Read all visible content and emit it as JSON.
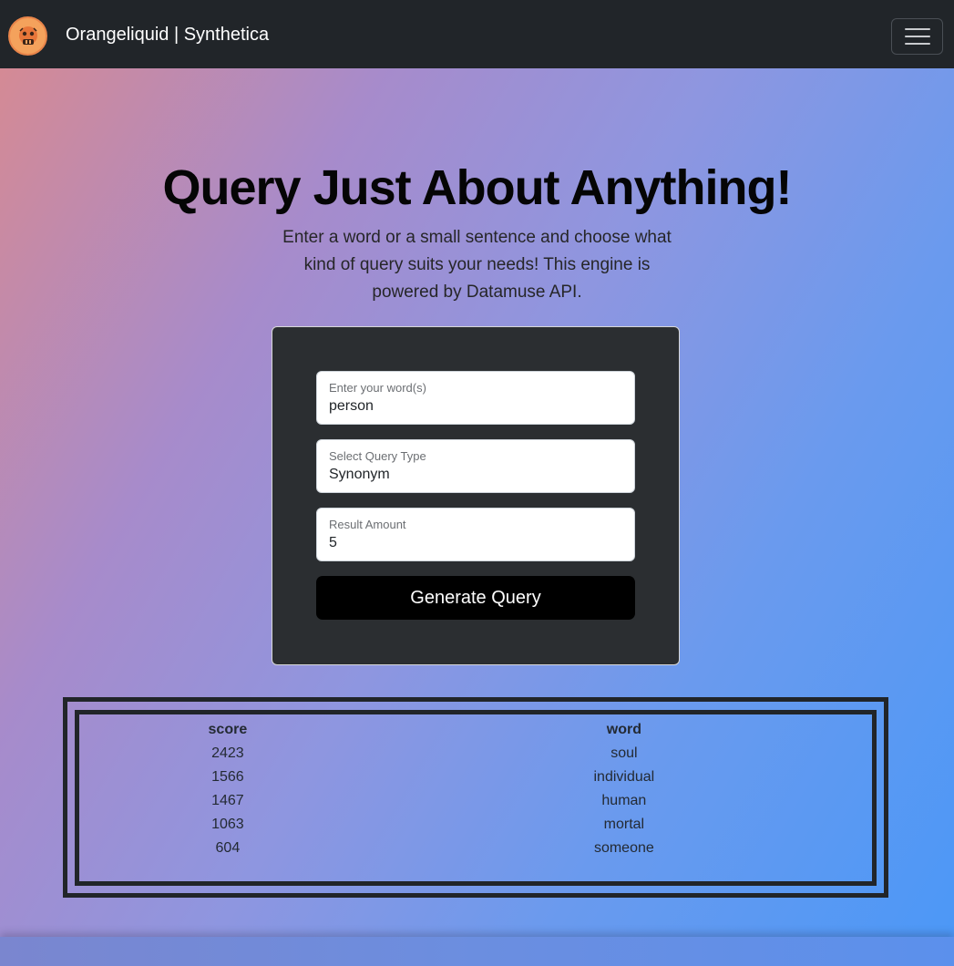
{
  "navbar": {
    "brand": "Orangeliquid | Synthetica",
    "logo_icon": "orange-mascot-icon",
    "menu_icon": "hamburger-menu-icon"
  },
  "hero": {
    "title": "Query Just About Anything!",
    "subtitle": "Enter a word or a small sentence and choose what kind of query suits your needs! This engine is powered by Datamuse API."
  },
  "form": {
    "word": {
      "label": "Enter your word(s)",
      "value": "person"
    },
    "query_type": {
      "label": "Select Query Type",
      "value": "Synonym"
    },
    "amount": {
      "label": "Result Amount",
      "value": "5"
    },
    "submit_label": "Generate Query"
  },
  "results": {
    "headers": [
      "score",
      "word"
    ],
    "rows": [
      [
        "2423",
        "soul"
      ],
      [
        "1566",
        "individual"
      ],
      [
        "1467",
        "human"
      ],
      [
        "1063",
        "mortal"
      ],
      [
        "604",
        "someone"
      ]
    ]
  },
  "colors": {
    "navbar_bg": "#212529",
    "card_bg": "#2b2e31",
    "button_bg": "#000000",
    "gradient_start": "#d98a8f",
    "gradient_end": "#4b98f7"
  }
}
